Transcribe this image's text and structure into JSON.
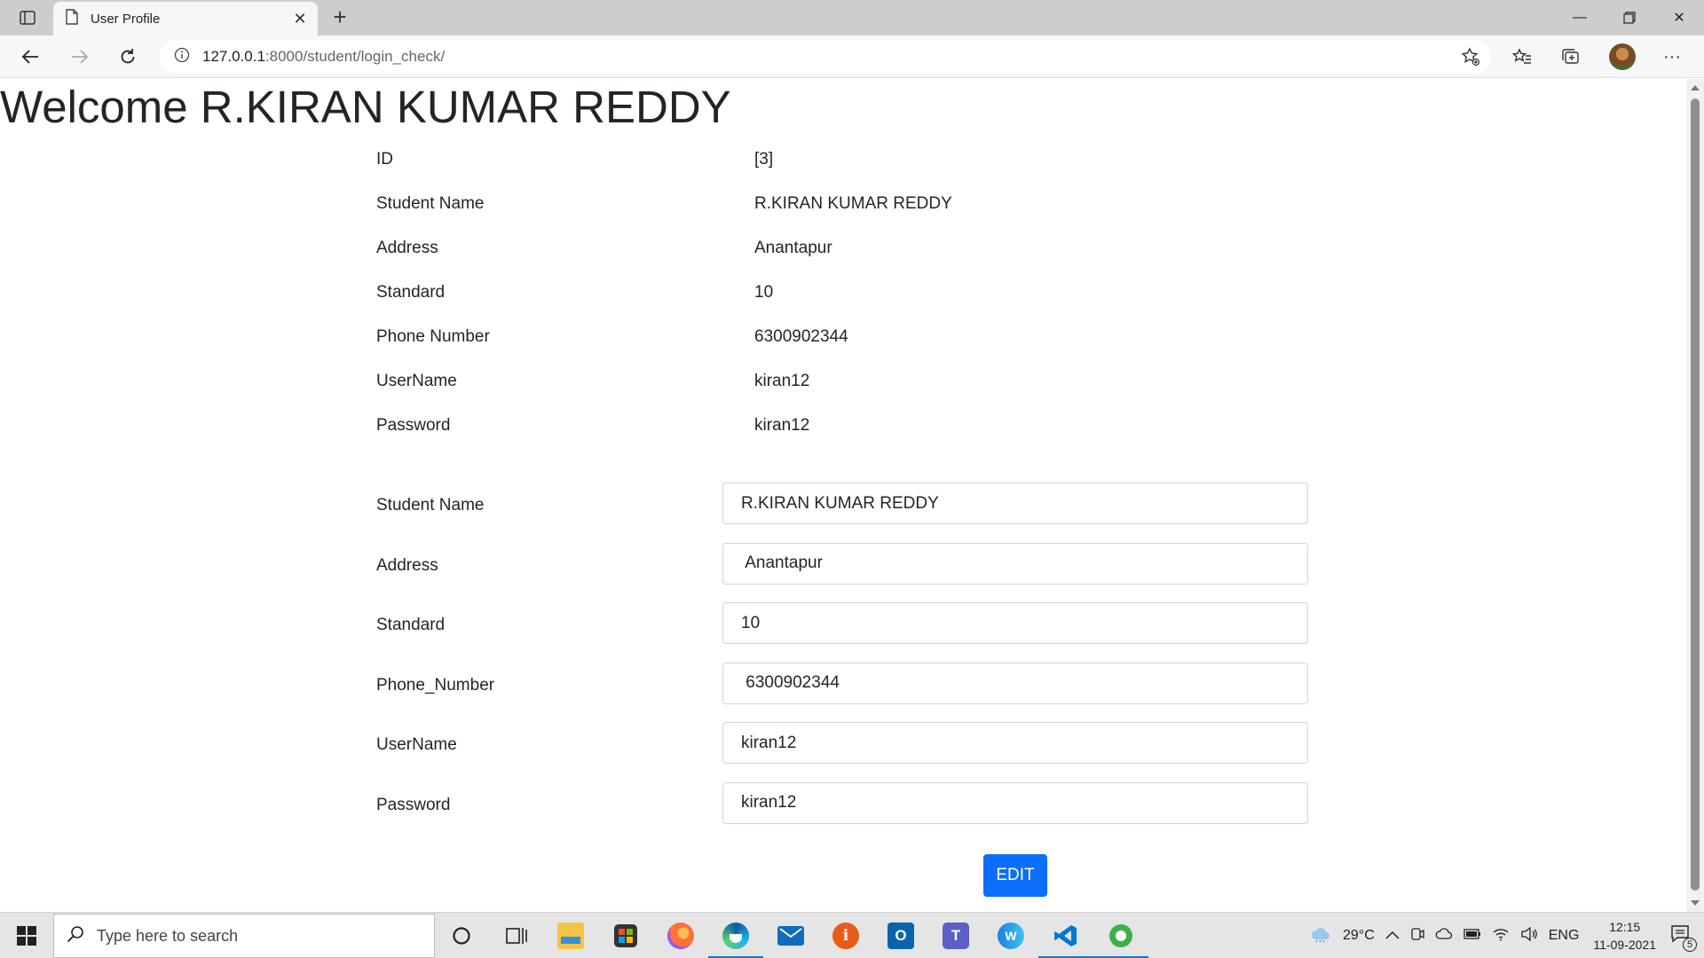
{
  "browser": {
    "tab_title": "User Profile",
    "url_host": "127.0.0.1",
    "url_path": ":8000/student/login_check/"
  },
  "page": {
    "welcome": "Welcome R.KIRAN KUMAR REDDY",
    "info": [
      {
        "label": "ID",
        "value": "[3]"
      },
      {
        "label": "Student Name",
        "value": "R.KIRAN KUMAR REDDY"
      },
      {
        "label": "Address",
        "value": "Anantapur"
      },
      {
        "label": "Standard",
        "value": "10"
      },
      {
        "label": "Phone Number",
        "value": "6300902344"
      },
      {
        "label": "UserName",
        "value": "kiran12"
      },
      {
        "label": "Password",
        "value": "kiran12"
      }
    ],
    "form": [
      {
        "label": "Student Name",
        "value": "R.KIRAN KUMAR REDDY"
      },
      {
        "label": "Address",
        "value": " Anantapur"
      },
      {
        "label": "Standard",
        "value": "10"
      },
      {
        "label": "Phone_Number",
        "value": " 6300902344"
      },
      {
        "label": "UserName",
        "value": "kiran12"
      },
      {
        "label": "Password",
        "value": "kiran12"
      }
    ],
    "edit_button": "EDIT"
  },
  "taskbar": {
    "search_placeholder": "Type here to search",
    "temperature": "29°C",
    "language": "ENG",
    "time": "12:15",
    "date": "11-09-2021",
    "notification_count": "5"
  },
  "colors": {
    "primary_button": "#0d6efd",
    "active_indicator": "#0078d4"
  }
}
